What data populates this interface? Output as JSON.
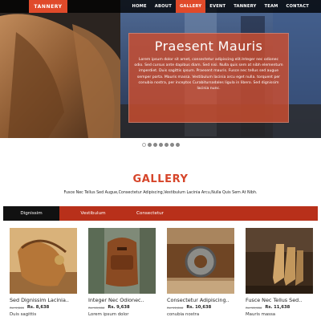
{
  "brand": "TANNERY",
  "nav": [
    "HOME",
    "ABOUT",
    "GALLERY",
    "EVENT",
    "TANNERY",
    "TEAM",
    "CONTACT"
  ],
  "nav_active": "GALLERY",
  "hero": {
    "title": "Praesent Mauris",
    "text": "Lorem ipsum dolor sit amet, consectetur adipiscing elit.Integer nec odionec odio. Sed cursus ante dapibus diam. Sed nisi. Nulla quis sem at nibh elementum imperdiet. Duis sagittis ipsum. Praesent mauris. Fusce nec tellus sed augue semper porta. Mauris massa. Vestibulum lacinia arcu eget nulla. torquent per conubia nostra, per inceptos Curabitursodales ligula in libero. Sed dignissim lacinia nunc."
  },
  "slider": {
    "count": 7,
    "active_index": 0
  },
  "gallery": {
    "title": "GALLERY",
    "subtitle": "Fusce Nec Tellus Sed Augue,Consectetur Adipiscing,Vestibulum Lacinia Arcu,Nulla Quis Sem At Nibh.",
    "tabs": [
      "Dignissim",
      "Vestibulum",
      "Consectetur"
    ],
    "active_tab": "Dignissim"
  },
  "products": [
    {
      "name": "Sed Dignissim Lacinia..",
      "old_price": "Rs. 9,846",
      "price": "Rs. 8,638",
      "desc": "Duis sagittis",
      "image": "leather-bag-on-table"
    },
    {
      "name": "Integer Nec Odionec..",
      "old_price": "Rs. 10,986",
      "price": "Rs. 9,638",
      "desc": "Lorem ipsum dolor",
      "image": "leather-backpack"
    },
    {
      "name": "Consectetur Adipiscing..",
      "old_price": "Rs. 11,846",
      "price": "Rs. 10,638",
      "desc": "conubia nostra",
      "image": "leather-belt-buckle"
    },
    {
      "name": "Fusce Nec Tellus Sed..",
      "old_price": "Rs. 12,986",
      "price": "Rs. 11,638",
      "desc": "Mauris massa",
      "image": "leather-boots"
    }
  ],
  "colors": {
    "accent": "#e04a2a",
    "tab_bar": "#b8301a",
    "active_tab": "#111111",
    "title": "#d6452a"
  }
}
